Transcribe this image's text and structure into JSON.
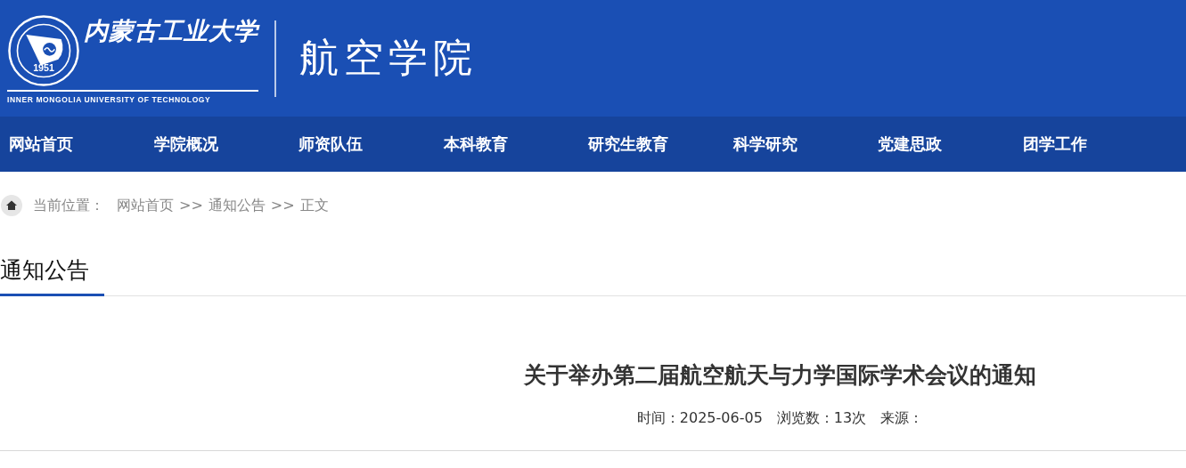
{
  "header": {
    "logo": {
      "year": "1951",
      "name_zh": "内蒙古工业大学",
      "name_en": "INNER MONGOLIA UNIVERSITY OF TECHNOLOGY"
    },
    "college": "航空学院"
  },
  "nav": [
    {
      "label": "网站首页"
    },
    {
      "label": "学院概况"
    },
    {
      "label": "师资队伍"
    },
    {
      "label": "本科教育"
    },
    {
      "label": "研究生教育"
    },
    {
      "label": "科学研究"
    },
    {
      "label": "党建思政"
    },
    {
      "label": "团学工作"
    }
  ],
  "breadcrumb": {
    "label": "当前位置：",
    "items": [
      "网站首页",
      ">>",
      "通知公告",
      ">>",
      "正文"
    ]
  },
  "section_title": "通知公告",
  "article": {
    "title": "关于举办第二届航空航天与力学国际学术会议的通知",
    "meta": [
      "时间：2025-06-05",
      "浏览数：13次",
      "来源："
    ]
  }
}
